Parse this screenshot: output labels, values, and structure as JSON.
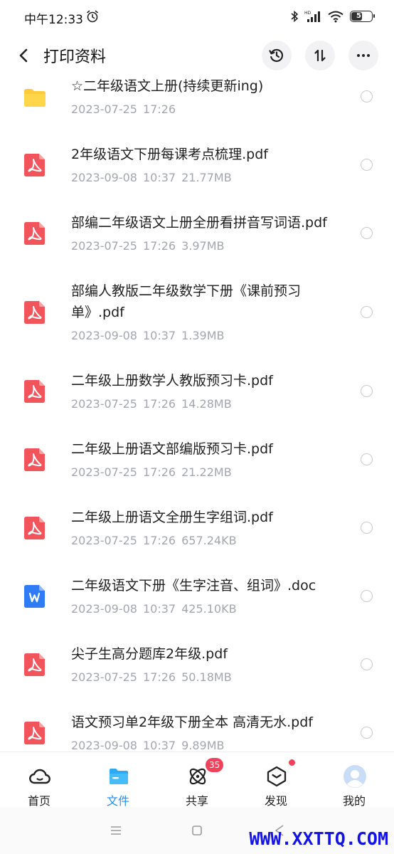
{
  "status_bar": {
    "time": "中午12:33",
    "battery": "57",
    "battery_level": 0.57
  },
  "header": {
    "title": "打印资料",
    "back_icon": "chevron-left-icon",
    "actions": [
      "history-icon",
      "sort-icon",
      "more-icon"
    ]
  },
  "files": [
    {
      "type": "folder",
      "name": "☆二年级语文上册(持续更新ing)",
      "date": "2023-07-25",
      "time": "17:26",
      "size": ""
    },
    {
      "type": "pdf",
      "name": "2年级语文下册每课考点梳理.pdf",
      "date": "2023-09-08",
      "time": "10:37",
      "size": "21.77MB"
    },
    {
      "type": "pdf",
      "name": "部编二年级语文上册全册看拼音写词语.pdf",
      "date": "2023-07-25",
      "time": "17:26",
      "size": "3.97MB"
    },
    {
      "type": "pdf",
      "name": "部编人教版二年级数学下册《课前预习单》.pdf",
      "date": "2023-09-08",
      "time": "10:37",
      "size": "1.39MB"
    },
    {
      "type": "pdf",
      "name": "二年级上册数学人教版预习卡.pdf",
      "date": "2023-07-25",
      "time": "17:26",
      "size": "14.28MB"
    },
    {
      "type": "pdf",
      "name": "二年级上册语文部编版预习卡.pdf",
      "date": "2023-07-25",
      "time": "17:26",
      "size": "21.22MB"
    },
    {
      "type": "pdf",
      "name": "二年级上册语文全册生字组词.pdf",
      "date": "2023-07-25",
      "time": "17:26",
      "size": "657.24KB"
    },
    {
      "type": "doc",
      "name": "二年级语文下册《生字注音、组词》.doc",
      "date": "2023-09-08",
      "time": "10:37",
      "size": "425.10KB"
    },
    {
      "type": "pdf",
      "name": "尖子生高分题库2年级.pdf",
      "date": "2023-07-25",
      "time": "17:26",
      "size": "50.18MB"
    },
    {
      "type": "pdf",
      "name": "语文预习单2年级下册全本 高清无水.pdf",
      "date": "2023-09-08",
      "time": "10:37",
      "size": "9.89MB"
    }
  ],
  "nav": [
    {
      "label": "首页",
      "icon": "cloud-home-icon"
    },
    {
      "label": "文件",
      "icon": "folder-icon",
      "active": true
    },
    {
      "label": "共享",
      "icon": "share-atom-icon",
      "badge": "35"
    },
    {
      "label": "发现",
      "icon": "discover-cube-icon",
      "dot": true
    },
    {
      "label": "我的",
      "icon": "avatar-icon"
    }
  ],
  "watermark": "WWW.XXTTQ.COM",
  "colors": {
    "accent": "#1890ff",
    "pdf": "#f2545b",
    "doc": "#2f7cf6",
    "folder": "#fdcb3a",
    "badge": "#f2415a",
    "meta": "#a3a6ad"
  }
}
